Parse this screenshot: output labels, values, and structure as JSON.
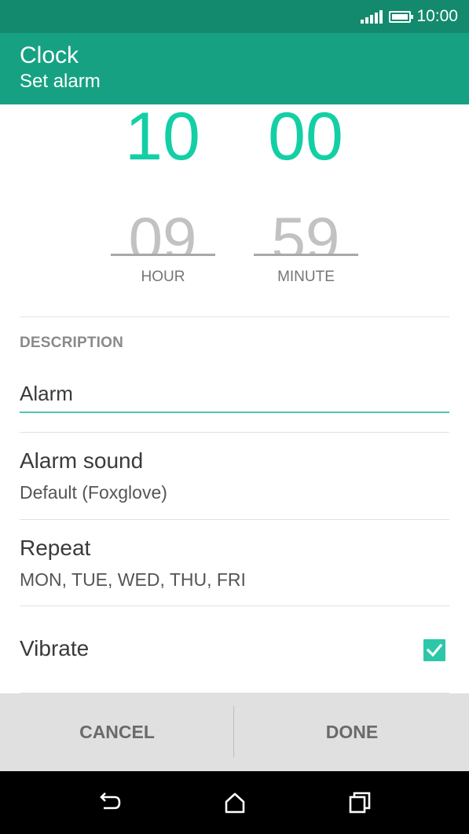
{
  "status_bar": {
    "time": "10:00"
  },
  "app_bar": {
    "title": "Clock",
    "subtitle": "Set alarm"
  },
  "time_picker": {
    "hour": {
      "value": "10",
      "previous": "09",
      "label": "HOUR"
    },
    "minute": {
      "value": "00",
      "previous": "59",
      "label": "MINUTE"
    }
  },
  "description": {
    "header": "DESCRIPTION",
    "value": "Alarm"
  },
  "settings": {
    "alarm_sound": {
      "label": "Alarm sound",
      "value": "Default (Foxglove)"
    },
    "repeat": {
      "label": "Repeat",
      "value": "MON, TUE, WED, THU, FRI"
    },
    "vibrate": {
      "label": "Vibrate",
      "checked": true
    }
  },
  "actions": {
    "cancel": "CANCEL",
    "done": "DONE"
  },
  "colors": {
    "status_bar": "#138a6d",
    "app_bar": "#16a282",
    "accent": "#14cfa5",
    "checkbox": "#2cc7a8"
  },
  "icons": {
    "back": "back-icon",
    "home": "home-icon",
    "recents": "recents-icon"
  }
}
